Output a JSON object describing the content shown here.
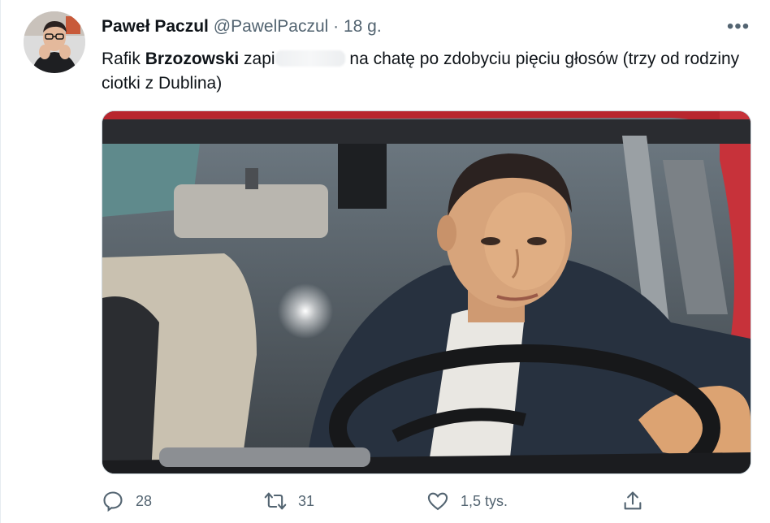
{
  "author": {
    "name": "Paweł Paczul",
    "handle": "@PawelPaczul",
    "separator": "·",
    "time": "18 g."
  },
  "tweet": {
    "text_before": "Rafik ",
    "text_bold": "Brzozowski",
    "text_mid": " zapi",
    "text_after": " na chatę po zdobyciu pięciu głosów (trzy od rodziny ciotki z Dublina)"
  },
  "media": {
    "icon": "photo-man-driving-red-car"
  },
  "actions": {
    "reply_count": "28",
    "retweet_count": "31",
    "like_count": "1,5 tys."
  },
  "colors": {
    "text": "#0f1419",
    "muted": "#536471",
    "car_red": "#b8262e"
  }
}
